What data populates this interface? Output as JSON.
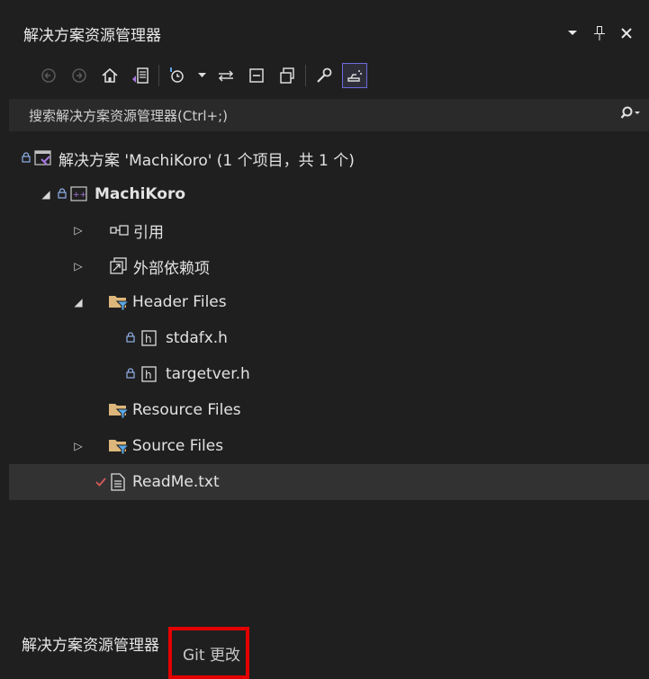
{
  "window": {
    "title": "解决方案资源管理器",
    "dropdown_icon": "chevron-down-icon",
    "pin_icon": "pin-icon",
    "close_icon": "close-icon"
  },
  "toolbar": {
    "items": [
      "back-icon",
      "forward-icon",
      "home-icon",
      "switch-views-icon",
      "pending-changes-filter-icon",
      "sync-icon",
      "collapse-all-icon",
      "show-all-files-icon",
      "properties-icon",
      "preview-selected-items-icon"
    ]
  },
  "search": {
    "placeholder": "搜索解决方案资源管理器(Ctrl+;)"
  },
  "tree": {
    "solution": "解决方案 'MachiKoro' (1 个项目，共 1 个)",
    "project": "MachiKoro",
    "references": "引用",
    "external_deps": "外部依赖项",
    "header_files": "Header Files",
    "stdafx": "stdafx.h",
    "targetver": "targetver.h",
    "resource_files": "Resource Files",
    "source_files": "Source Files",
    "readme": "ReadMe.txt"
  },
  "tabs": {
    "solution_explorer": "解决方案资源管理器",
    "git_changes": "Git 更改"
  },
  "colors": {
    "background": "#1f1f1f",
    "highlight_border": "#e50000",
    "lock": "#8fb0e8",
    "check": "#d85a5a",
    "folder": "#dcb67a"
  }
}
